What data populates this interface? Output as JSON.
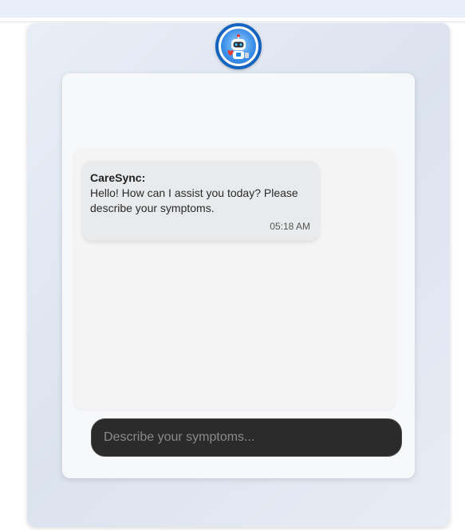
{
  "chat": {
    "messages": [
      {
        "sender": "CareSync:",
        "text": "Hello! How can I assist you today? Please describe your symptoms.",
        "time": "05:18 AM"
      }
    ]
  },
  "input": {
    "placeholder": "Describe your symptoms...",
    "value": ""
  },
  "icons": {
    "avatar": "robot-doctor-icon"
  },
  "colors": {
    "avatar_ring": "#1565c0",
    "input_bg": "#2b2b2b",
    "bubble_bg": "#e8eaec"
  }
}
